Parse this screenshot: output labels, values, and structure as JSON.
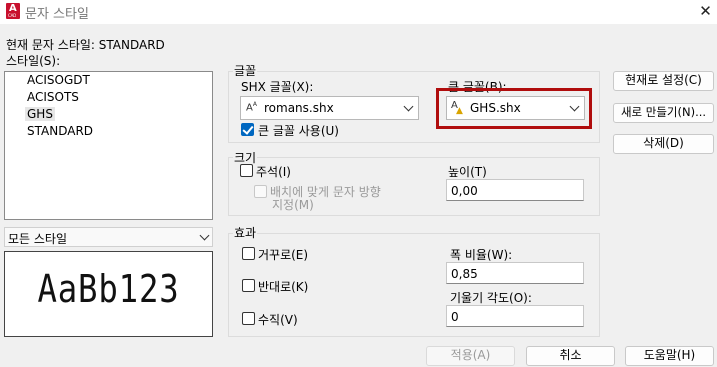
{
  "window": {
    "title": "문자 스타일",
    "app_badge": "A",
    "app_badge_sub": "CAD"
  },
  "current_style_label": "현재 문자 스타일: STANDARD",
  "styles": {
    "label": "스타일(S):",
    "items": [
      "ACISOGDT",
      "ACISOTS",
      "GHS",
      "STANDARD"
    ],
    "selected": "GHS"
  },
  "style_filter": {
    "value": "모든 스타일"
  },
  "preview": {
    "text": "AaBb123"
  },
  "font": {
    "group_title": "글꼴",
    "shx_label": "SHX 글꼴(X):",
    "shx_value": "romans.shx",
    "bigfont_label": "큰 글꼴(B):",
    "bigfont_value": "GHS.shx",
    "use_bigfont_label": "큰 글꼴 사용(U)",
    "use_bigfont_checked": true
  },
  "size": {
    "group_title": "크기",
    "annotative_label": "주석(I)",
    "match_orientation_label_1": "배치에 맞게 문자 방향",
    "match_orientation_label_2": "지정(M)",
    "height_label": "높이(T)",
    "height_value": "0,00"
  },
  "effects": {
    "group_title": "효과",
    "upside_down_label": "거꾸로(E)",
    "backwards_label": "반대로(K)",
    "vertical_label": "수직(V)",
    "width_factor_label": "폭 비율(W):",
    "width_factor_value": "0,85",
    "oblique_label": "기울기 각도(O):",
    "oblique_value": "0"
  },
  "buttons": {
    "set_current": "현재로 설정(C)",
    "new": "새로 만들기(N)...",
    "delete": "삭제(D)",
    "apply": "적용(A)",
    "cancel": "취소",
    "help": "도움말(H)"
  },
  "colors": {
    "highlight_border": "#b00d0d",
    "checkbox_checked": "#0067c0",
    "app_icon": "#c8102e"
  }
}
